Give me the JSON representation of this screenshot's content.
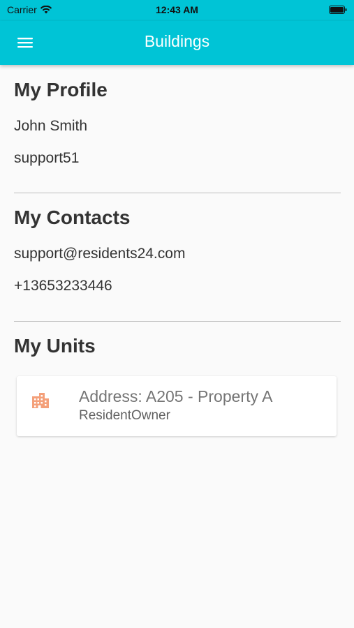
{
  "status_bar": {
    "carrier": "Carrier",
    "time": "12:43 AM"
  },
  "app_bar": {
    "title": "Buildings",
    "menu_icon": "hamburger-menu-icon",
    "background_color": "#00c4d6"
  },
  "profile": {
    "heading": "My Profile",
    "name": "John Smith",
    "username": "support51"
  },
  "contacts": {
    "heading": "My Contacts",
    "email": "support@residents24.com",
    "phone": "+13653233446"
  },
  "units": {
    "heading": "My Units",
    "items": [
      {
        "address": "Address: A205 - Property A",
        "role": "ResidentOwner",
        "icon": "building-icon",
        "icon_color": "#f4a07a"
      }
    ]
  }
}
